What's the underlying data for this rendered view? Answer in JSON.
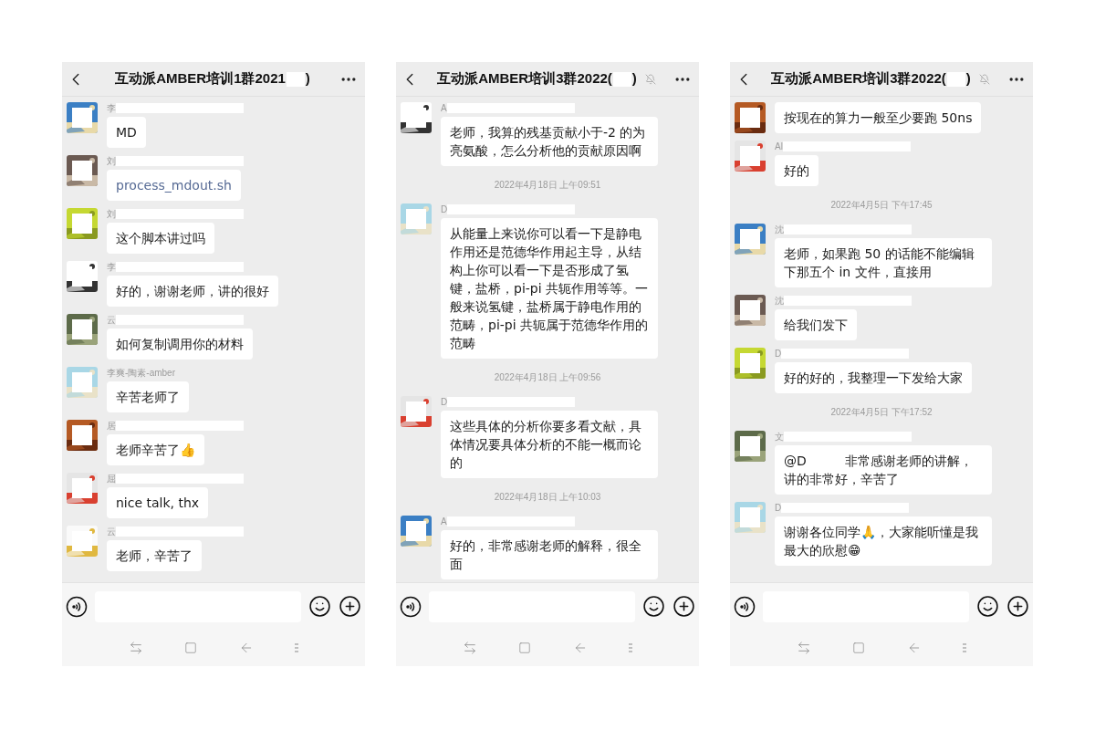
{
  "phones": [
    {
      "header": {
        "title": "互动派AMBER培训1群2021",
        "title_suffix": ")",
        "muted": false
      },
      "messages": [
        {
          "kind": "message",
          "sender": "李",
          "redacted": true,
          "text": "MD"
        },
        {
          "kind": "link",
          "sender": "刘",
          "redacted": true,
          "text": "process_mdout.sh"
        },
        {
          "kind": "message",
          "sender": "刘",
          "redacted": true,
          "text": "这个脚本讲过吗"
        },
        {
          "kind": "message",
          "sender": "李",
          "redacted": true,
          "text": "好的，谢谢老师，讲的很好"
        },
        {
          "kind": "message",
          "sender": "云",
          "redacted": true,
          "text": "如何复制调用你的材料"
        },
        {
          "kind": "message",
          "sender": "李爽-陶素-amber",
          "redacted": false,
          "text": "辛苦老师了"
        },
        {
          "kind": "message",
          "sender": "居",
          "redacted": true,
          "text": "老师辛苦了👍"
        },
        {
          "kind": "message",
          "sender": "屈",
          "redacted": true,
          "text": "nice talk, thx"
        },
        {
          "kind": "message",
          "sender": "云",
          "redacted": true,
          "text": "老师，辛苦了"
        }
      ]
    },
    {
      "header": {
        "title": "互动派AMBER培训3群2022(",
        "title_suffix": ")",
        "muted": true
      },
      "messages": [
        {
          "kind": "message",
          "sender": "A",
          "redacted": true,
          "text": "老师，我算的残基贡献小于-2 的为亮氨酸，怎么分析他的贡献原因啊"
        },
        {
          "kind": "time",
          "text": "2022年4月18日 上午09:51"
        },
        {
          "kind": "message",
          "sender": "D",
          "redacted": true,
          "text": "从能量上来说你可以看一下是静电作用还是范德华作用起主导，从结构上你可以看一下是否形成了氢键，盐桥，pi-pi 共轭作用等等。一般来说氢键，盐桥属于静电作用的范畴，pi-pi 共轭属于范德华作用的范畴"
        },
        {
          "kind": "time",
          "text": "2022年4月18日 上午09:56"
        },
        {
          "kind": "message",
          "sender": "D",
          "redacted": true,
          "text": "这些具体的分析你要多看文献，具体情况要具体分析的不能一概而论的"
        },
        {
          "kind": "time",
          "text": "2022年4月18日 上午10:03"
        },
        {
          "kind": "message",
          "sender": "A",
          "redacted": true,
          "text": "好的，非常感谢老师的解释，很全面"
        }
      ]
    },
    {
      "header": {
        "title": "互动派AMBER培训3群2022(",
        "title_suffix": ")",
        "muted": true
      },
      "messages": [
        {
          "kind": "message",
          "redacted": false,
          "text": "按现在的算力一般至少要跑 50ns"
        },
        {
          "kind": "message",
          "sender": "Al",
          "redacted": true,
          "text": "好的"
        },
        {
          "kind": "time",
          "text": "2022年4月5日 下午17:45"
        },
        {
          "kind": "message",
          "sender": "沈",
          "redacted": true,
          "text": "老师，如果跑 50 的话能不能编辑下那五个 in 文件，直接用"
        },
        {
          "kind": "message",
          "sender": "沈",
          "redacted": true,
          "text": "给我们发下"
        },
        {
          "kind": "message",
          "sender": "D",
          "redacted": true,
          "text": "好的好的，我整理一下发给大家"
        },
        {
          "kind": "time",
          "text": "2022年4月5日 下午17:52"
        },
        {
          "kind": "message",
          "sender": "文",
          "redacted": true,
          "text": "@D　　　非常感谢老师的讲解，讲的非常好，辛苦了"
        },
        {
          "kind": "message",
          "sender": "D",
          "redacted": true,
          "text": "谢谢各位同学🙏，大家能听懂是我最大的欣慰😁"
        }
      ]
    }
  ]
}
